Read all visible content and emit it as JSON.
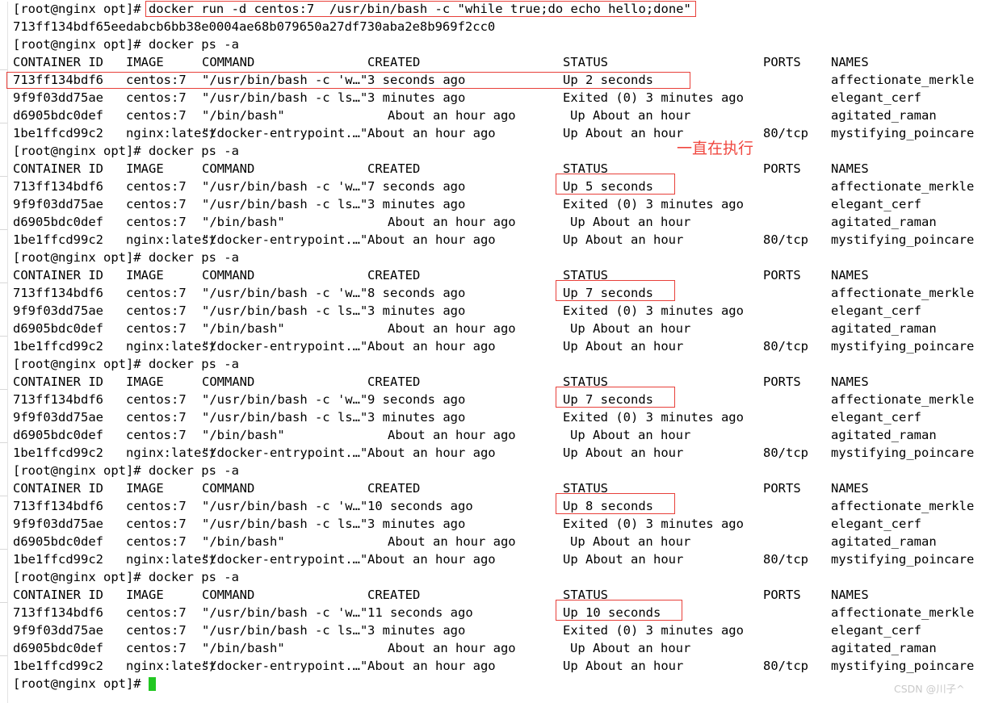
{
  "terminal": {
    "prompt": "[root@nginx opt]# ",
    "background_color": "#ffffff",
    "text_color": "#000000",
    "accent_red": "#e8403a",
    "cursor_color": "#22c722"
  },
  "annotation": {
    "text": "一直在执行",
    "color": "#f0473f"
  },
  "watermark": {
    "text": "CSDN @川子^"
  },
  "commands": {
    "docker_run": "docker run -d centos:7  /usr/bin/bash -c \"while true;do echo hello;done\"",
    "docker_ps": "docker ps -a",
    "container_hash": "713ff134bdf65eedabcb6bb38e0004ae68b079650a27df730aba2e8b969f2cc0"
  },
  "table_headers": {
    "container_id": "CONTAINER ID",
    "image": "IMAGE",
    "command": "COMMAND",
    "created": "CREATED",
    "status": "STATUS",
    "ports": "PORTS",
    "names": "NAMES"
  },
  "blocks": [
    {
      "id": "block-1",
      "rows": [
        {
          "container_id": "713ff134bdf6",
          "image": "centos:7",
          "command": "\"/usr/bin/bash -c 'w…\"",
          "created": "3 seconds ago",
          "status": "Up 2 seconds",
          "ports": "",
          "names": "affectionate_merkle",
          "highlight": "row"
        },
        {
          "container_id": "9f9f03dd75ae",
          "image": "centos:7",
          "command": "\"/usr/bin/bash -c ls…\"",
          "created": "3 minutes ago",
          "status": "Exited (0) 3 minutes ago",
          "ports": "",
          "names": "elegant_cerf",
          "highlight": ""
        },
        {
          "container_id": "d6905bdc0def",
          "image": "centos:7",
          "command": "\"/bin/bash\"",
          "created": "About an hour ago",
          "status": "Up About an hour",
          "ports": "",
          "names": "agitated_raman",
          "highlight": ""
        },
        {
          "container_id": "1be1ffcd99c2",
          "image": "nginx:latest",
          "command": "\"/docker-entrypoint.…\"",
          "created": "About an hour ago",
          "status": "Up About an hour",
          "ports": "80/tcp",
          "names": "mystifying_poincare",
          "highlight": ""
        }
      ]
    },
    {
      "id": "block-2",
      "rows": [
        {
          "container_id": "713ff134bdf6",
          "image": "centos:7",
          "command": "\"/usr/bin/bash -c 'w…\"",
          "created": "7 seconds ago",
          "status": "Up 5 seconds",
          "ports": "",
          "names": "affectionate_merkle",
          "highlight": "status"
        },
        {
          "container_id": "9f9f03dd75ae",
          "image": "centos:7",
          "command": "\"/usr/bin/bash -c ls…\"",
          "created": "3 minutes ago",
          "status": "Exited (0) 3 minutes ago",
          "ports": "",
          "names": "elegant_cerf",
          "highlight": ""
        },
        {
          "container_id": "d6905bdc0def",
          "image": "centos:7",
          "command": "\"/bin/bash\"",
          "created": "About an hour ago",
          "status": "Up About an hour",
          "ports": "",
          "names": "agitated_raman",
          "highlight": ""
        },
        {
          "container_id": "1be1ffcd99c2",
          "image": "nginx:latest",
          "command": "\"/docker-entrypoint.…\"",
          "created": "About an hour ago",
          "status": "Up About an hour",
          "ports": "80/tcp",
          "names": "mystifying_poincare",
          "highlight": ""
        }
      ]
    },
    {
      "id": "block-3",
      "rows": [
        {
          "container_id": "713ff134bdf6",
          "image": "centos:7",
          "command": "\"/usr/bin/bash -c 'w…\"",
          "created": "8 seconds ago",
          "status": "Up 7 seconds",
          "ports": "",
          "names": "affectionate_merkle",
          "highlight": "status"
        },
        {
          "container_id": "9f9f03dd75ae",
          "image": "centos:7",
          "command": "\"/usr/bin/bash -c ls…\"",
          "created": "3 minutes ago",
          "status": "Exited (0) 3 minutes ago",
          "ports": "",
          "names": "elegant_cerf",
          "highlight": ""
        },
        {
          "container_id": "d6905bdc0def",
          "image": "centos:7",
          "command": "\"/bin/bash\"",
          "created": "About an hour ago",
          "status": "Up About an hour",
          "ports": "",
          "names": "agitated_raman",
          "highlight": ""
        },
        {
          "container_id": "1be1ffcd99c2",
          "image": "nginx:latest",
          "command": "\"/docker-entrypoint.…\"",
          "created": "About an hour ago",
          "status": "Up About an hour",
          "ports": "80/tcp",
          "names": "mystifying_poincare",
          "highlight": ""
        }
      ]
    },
    {
      "id": "block-4",
      "rows": [
        {
          "container_id": "713ff134bdf6",
          "image": "centos:7",
          "command": "\"/usr/bin/bash -c 'w…\"",
          "created": "9 seconds ago",
          "status": "Up 7 seconds",
          "ports": "",
          "names": "affectionate_merkle",
          "highlight": "status"
        },
        {
          "container_id": "9f9f03dd75ae",
          "image": "centos:7",
          "command": "\"/usr/bin/bash -c ls…\"",
          "created": "3 minutes ago",
          "status": "Exited (0) 3 minutes ago",
          "ports": "",
          "names": "elegant_cerf",
          "highlight": ""
        },
        {
          "container_id": "d6905bdc0def",
          "image": "centos:7",
          "command": "\"/bin/bash\"",
          "created": "About an hour ago",
          "status": "Up About an hour",
          "ports": "",
          "names": "agitated_raman",
          "highlight": ""
        },
        {
          "container_id": "1be1ffcd99c2",
          "image": "nginx:latest",
          "command": "\"/docker-entrypoint.…\"",
          "created": "About an hour ago",
          "status": "Up About an hour",
          "ports": "80/tcp",
          "names": "mystifying_poincare",
          "highlight": ""
        }
      ]
    },
    {
      "id": "block-5",
      "rows": [
        {
          "container_id": "713ff134bdf6",
          "image": "centos:7",
          "command": "\"/usr/bin/bash -c 'w…\"",
          "created": "10 seconds ago",
          "status": "Up 8 seconds",
          "ports": "",
          "names": "affectionate_merkle",
          "highlight": "status"
        },
        {
          "container_id": "9f9f03dd75ae",
          "image": "centos:7",
          "command": "\"/usr/bin/bash -c ls…\"",
          "created": "3 minutes ago",
          "status": "Exited (0) 3 minutes ago",
          "ports": "",
          "names": "elegant_cerf",
          "highlight": ""
        },
        {
          "container_id": "d6905bdc0def",
          "image": "centos:7",
          "command": "\"/bin/bash\"",
          "created": "About an hour ago",
          "status": "Up About an hour",
          "ports": "",
          "names": "agitated_raman",
          "highlight": ""
        },
        {
          "container_id": "1be1ffcd99c2",
          "image": "nginx:latest",
          "command": "\"/docker-entrypoint.…\"",
          "created": "About an hour ago",
          "status": "Up About an hour",
          "ports": "80/tcp",
          "names": "mystifying_poincare",
          "highlight": ""
        }
      ]
    },
    {
      "id": "block-6",
      "rows": [
        {
          "container_id": "713ff134bdf6",
          "image": "centos:7",
          "command": "\"/usr/bin/bash -c 'w…\"",
          "created": "11 seconds ago",
          "status": "Up 10 seconds",
          "ports": "",
          "names": "affectionate_merkle",
          "highlight": "status"
        },
        {
          "container_id": "9f9f03dd75ae",
          "image": "centos:7",
          "command": "\"/usr/bin/bash -c ls…\"",
          "created": "3 minutes ago",
          "status": "Exited (0) 3 minutes ago",
          "ports": "",
          "names": "elegant_cerf",
          "highlight": ""
        },
        {
          "container_id": "d6905bdc0def",
          "image": "centos:7",
          "command": "\"/bin/bash\"",
          "created": "About an hour ago",
          "status": "Up About an hour",
          "ports": "",
          "names": "agitated_raman",
          "highlight": ""
        },
        {
          "container_id": "1be1ffcd99c2",
          "image": "nginx:latest",
          "command": "\"/docker-entrypoint.…\"",
          "created": "About an hour ago",
          "status": "Up About an hour",
          "ports": "80/tcp",
          "names": "mystifying_poincare",
          "highlight": ""
        }
      ]
    }
  ]
}
